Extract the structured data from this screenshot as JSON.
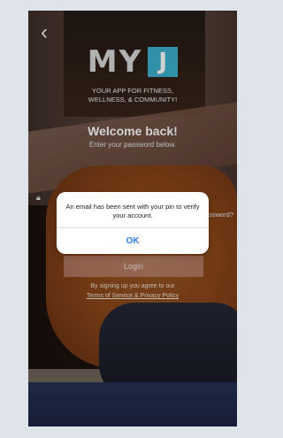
{
  "nav": {
    "back_icon": "chevron-left-icon",
    "back_glyph": "‹"
  },
  "brand": {
    "wordmark": "MY",
    "mark_letter": "J",
    "mark_color": "#3bb1cf"
  },
  "tagline": [
    "YOUR APP FOR FITNESS,",
    "WELLNESS, & COMMUNITY!"
  ],
  "heading": {
    "title": "Welcome back!",
    "subtitle": "Enter your password below."
  },
  "form": {
    "password_icon": "lock-icon",
    "forgot_link": "Password?",
    "login_button": "Login"
  },
  "terms": {
    "prefix": "By signing up you agree to our",
    "link": "Terms of Service & Privacy Policy"
  },
  "dialog": {
    "message": "An email has been sent with your pin to verify your account.",
    "ok_label": "OK",
    "ok_color": "#2f7fe0"
  }
}
